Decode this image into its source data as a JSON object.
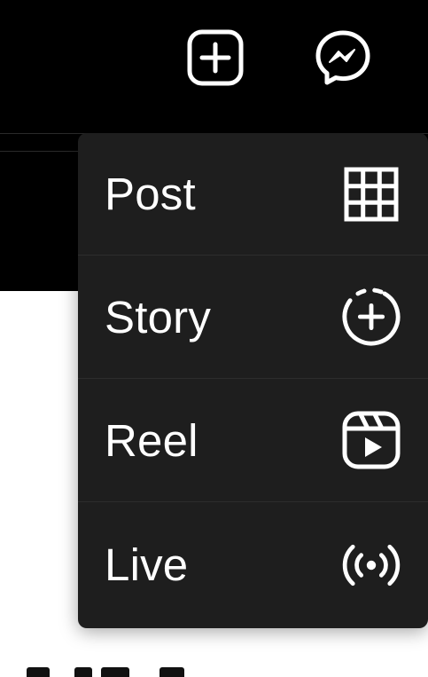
{
  "header": {
    "icons": [
      "create-icon",
      "messenger-icon"
    ]
  },
  "create_menu": {
    "items": [
      {
        "label": "Post",
        "icon": "grid-icon"
      },
      {
        "label": "Story",
        "icon": "story-add-icon"
      },
      {
        "label": "Reel",
        "icon": "reel-icon"
      },
      {
        "label": "Live",
        "icon": "live-broadcast-icon"
      }
    ]
  },
  "colors": {
    "header_bg": "#000000",
    "menu_bg": "#1e1e1e",
    "menu_text": "#ffffff",
    "divider": "#2d2d2d",
    "page_bg": "#ffffff"
  }
}
